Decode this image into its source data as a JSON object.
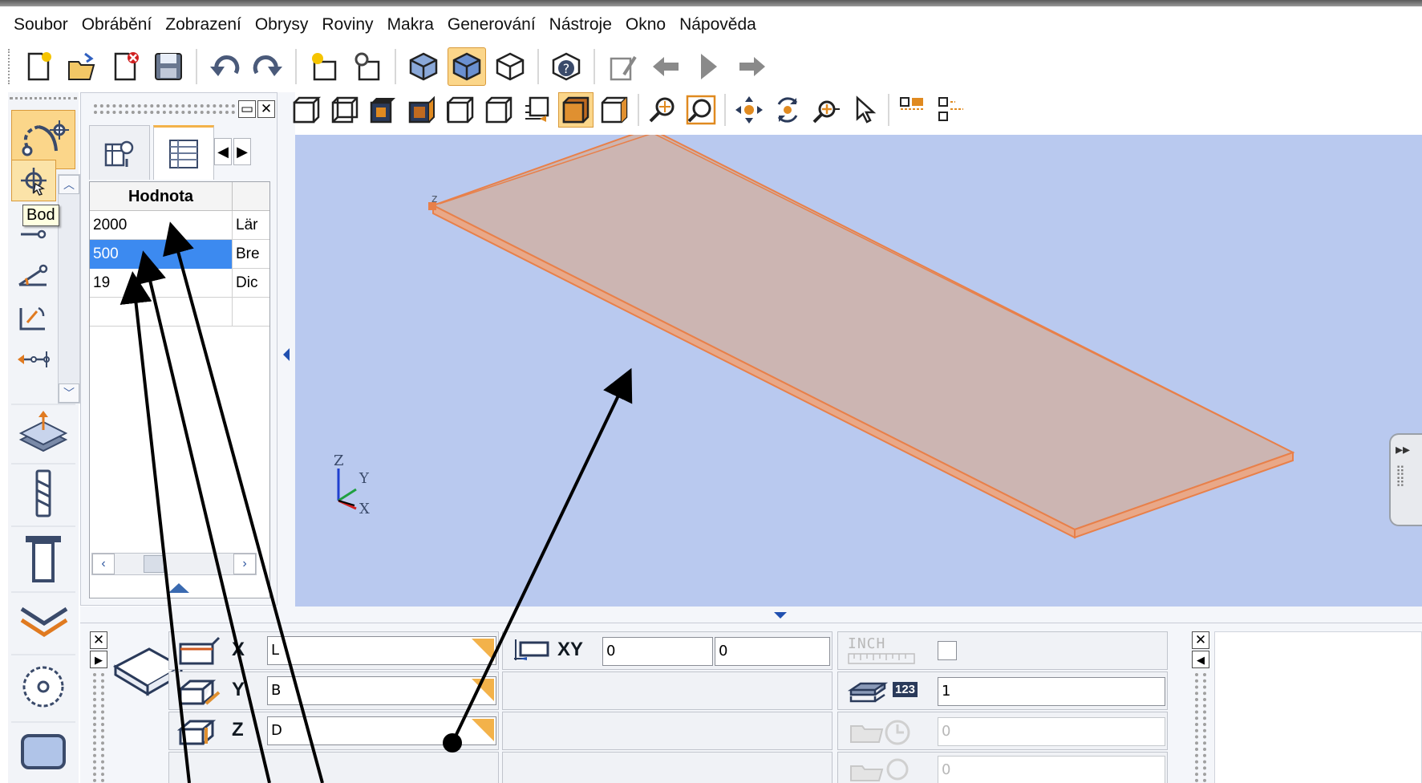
{
  "menu": {
    "items": [
      "Soubor",
      "Obrábění",
      "Zobrazení",
      "Obrysy",
      "Roviny",
      "Makra",
      "Generování",
      "Nástroje",
      "Okno",
      "Nápověda"
    ]
  },
  "toolbar": {
    "icons": [
      "new-file-icon",
      "open-file-icon",
      "close-file-icon",
      "save-icon",
      "undo-icon",
      "redo-icon",
      "new-workpiece-icon",
      "workpiece-settings-icon",
      "solid-view-icon",
      "shaded-view-icon",
      "wireframe-view-icon",
      "help-icon",
      "tool-edit-icon",
      "back-arrow-icon",
      "play-icon",
      "forward-arrow-icon"
    ]
  },
  "left_toolbar": {
    "tooltip": "Bod"
  },
  "properties_panel": {
    "column_header": "Hodnota",
    "rows": [
      {
        "value": "2000",
        "label": "Lär"
      },
      {
        "value": "500",
        "label": "Bre"
      },
      {
        "value": "19",
        "label": "Dic"
      }
    ],
    "selected_row": 1
  },
  "viewport": {
    "axes": {
      "z": "Z",
      "y": "Y",
      "x": "X"
    },
    "colors": {
      "background": "#b9c9ef",
      "panel_top": "#ccb5b2",
      "panel_edge": "#e8804a"
    }
  },
  "bottom_panel": {
    "x_label": "X",
    "y_label": "Y",
    "z_label": "Z",
    "x_value": "L",
    "y_value": "B",
    "z_value": "D",
    "xy_label": "XY",
    "xy_value_1": "0",
    "xy_value_2": "0",
    "inch_label": "INCH",
    "count_badge": "123",
    "count_value": "1",
    "dim_value_1": "0",
    "dim_value_2": "0"
  }
}
